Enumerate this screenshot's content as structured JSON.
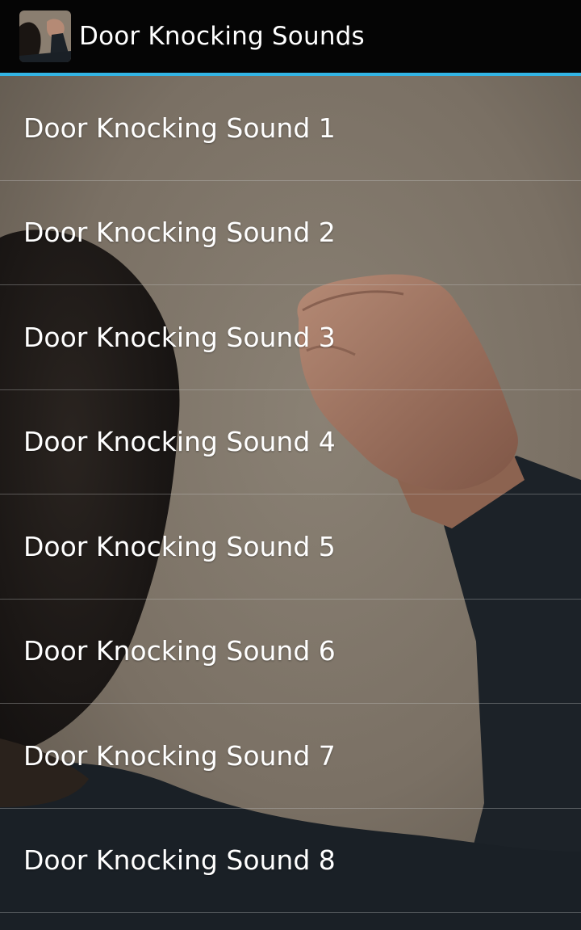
{
  "action_bar": {
    "title": "Door Knocking Sounds",
    "icon": "app-icon-knocking-fist",
    "accent_color": "#33b5e5"
  },
  "background": {
    "description_icon": "photo-person-knocking",
    "base_color": "#7d7468"
  },
  "sound_list": {
    "items": [
      {
        "label": "Door Knocking Sound 1"
      },
      {
        "label": "Door Knocking Sound 2"
      },
      {
        "label": "Door Knocking Sound 3"
      },
      {
        "label": "Door Knocking Sound 4"
      },
      {
        "label": "Door Knocking Sound 5"
      },
      {
        "label": "Door Knocking Sound 6"
      },
      {
        "label": "Door Knocking Sound 7"
      },
      {
        "label": "Door Knocking Sound 8"
      }
    ]
  }
}
